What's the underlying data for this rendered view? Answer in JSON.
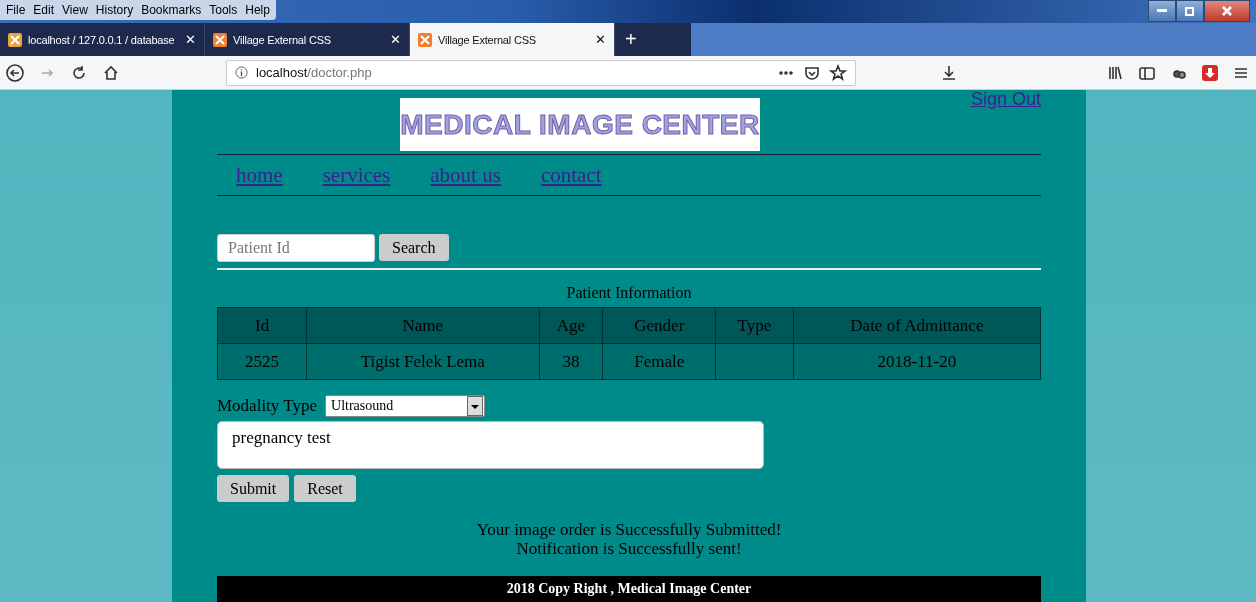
{
  "menu_bar": [
    "File",
    "Edit",
    "View",
    "History",
    "Bookmarks",
    "Tools",
    "Help"
  ],
  "tabs": [
    {
      "title": "localhost / 127.0.0.1 / database",
      "close": "✕",
      "selected": false
    },
    {
      "title": "Village External CSS",
      "close": "✕",
      "selected": false
    },
    {
      "title": "Village External CSS",
      "close": "✕",
      "selected": true
    }
  ],
  "new_tab": "+",
  "address_bar": {
    "host": "localhost",
    "path": "/doctor.php"
  },
  "page": {
    "logo": "MEDICAL IMAGE CENTER",
    "sign_out": "Sign Out",
    "nav": [
      "home",
      "services",
      "about us",
      "contact"
    ],
    "search": {
      "placeholder": "Patient Id",
      "button": "Search"
    },
    "table": {
      "caption": "Patient Information",
      "columns": [
        "Id",
        "Name",
        "Age",
        "Gender",
        "Type",
        "Date of Admittance"
      ],
      "rows": [
        [
          "2525",
          "Tigist Felek Lema",
          "38",
          "Female",
          "",
          "2018-11-20"
        ]
      ]
    },
    "modality": {
      "label": "Modality Type",
      "value": "Ultrasound"
    },
    "notes": {
      "value": "pregnancy test"
    },
    "buttons": [
      "Submit",
      "Reset"
    ],
    "messages": [
      "Your image order is Successfully Submitted!",
      "Notification is Successfully sent!"
    ],
    "footer": "2018 Copy Right , Medical Image Center"
  }
}
